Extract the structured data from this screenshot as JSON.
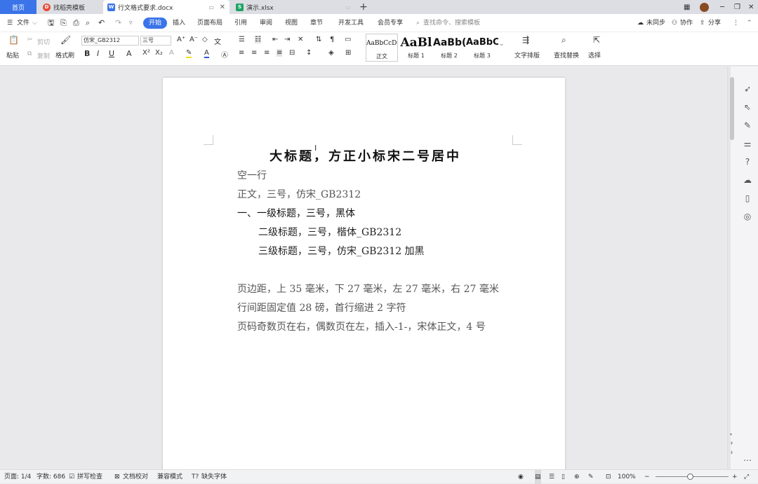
{
  "tabs": [
    {
      "label": "首页"
    },
    {
      "label": "找稻壳模板"
    },
    {
      "label": "行文格式要求.docx"
    },
    {
      "label": "演示.xlsx"
    }
  ],
  "new_tab": "+",
  "menu": {
    "file": "文件",
    "items": [
      "开始",
      "插入",
      "页面布局",
      "引用",
      "审阅",
      "视图",
      "章节",
      "开发工具",
      "会员专享"
    ],
    "search_placeholder": "查找命令、搜索模板",
    "sync": "未同步",
    "collab": "协作",
    "share": "分享"
  },
  "ribbon": {
    "paste": "粘贴",
    "cut": "剪切",
    "copy": "复制",
    "format_painter": "格式刷",
    "font_name": "仿宋_GB2312",
    "font_size": "三号",
    "styles": [
      {
        "preview": "AaBbCcDc",
        "label": "正文"
      },
      {
        "preview": "AaBl",
        "label": "标题 1"
      },
      {
        "preview": "AaBb(",
        "label": "标题 2"
      },
      {
        "preview": "AaBbC",
        "label": "标题 3"
      }
    ],
    "text_layout": "文字排版",
    "find_replace": "查找替换",
    "select": "选择"
  },
  "document": {
    "lines": [
      "大标题，方正小标宋二号居中",
      "空一行",
      "正文，三号，仿宋_GB2312",
      "一、一级标题，三号，黑体",
      "二级标题，三号，楷体_GB2312",
      "三级标题，三号，仿宋_GB2312 加黑",
      "",
      "页边距，上 35 毫米，下 27 毫米，左 27 毫米，右 27 毫米",
      "行间距固定值 28 磅，首行缩进 2 字符",
      "页码奇数页在右，偶数页在左，插入-1-，宋体正文，4 号"
    ]
  },
  "status": {
    "page": "页面: 1/4",
    "words": "字数: 686",
    "spell": "拼写检查",
    "proof": "文档校对",
    "compat": "兼容模式",
    "missing_font": "缺失字体",
    "zoom": "100%"
  },
  "colors": {
    "accent": "#3a74e8",
    "page": "#ffffff",
    "canvas": "#e9e9eb"
  }
}
